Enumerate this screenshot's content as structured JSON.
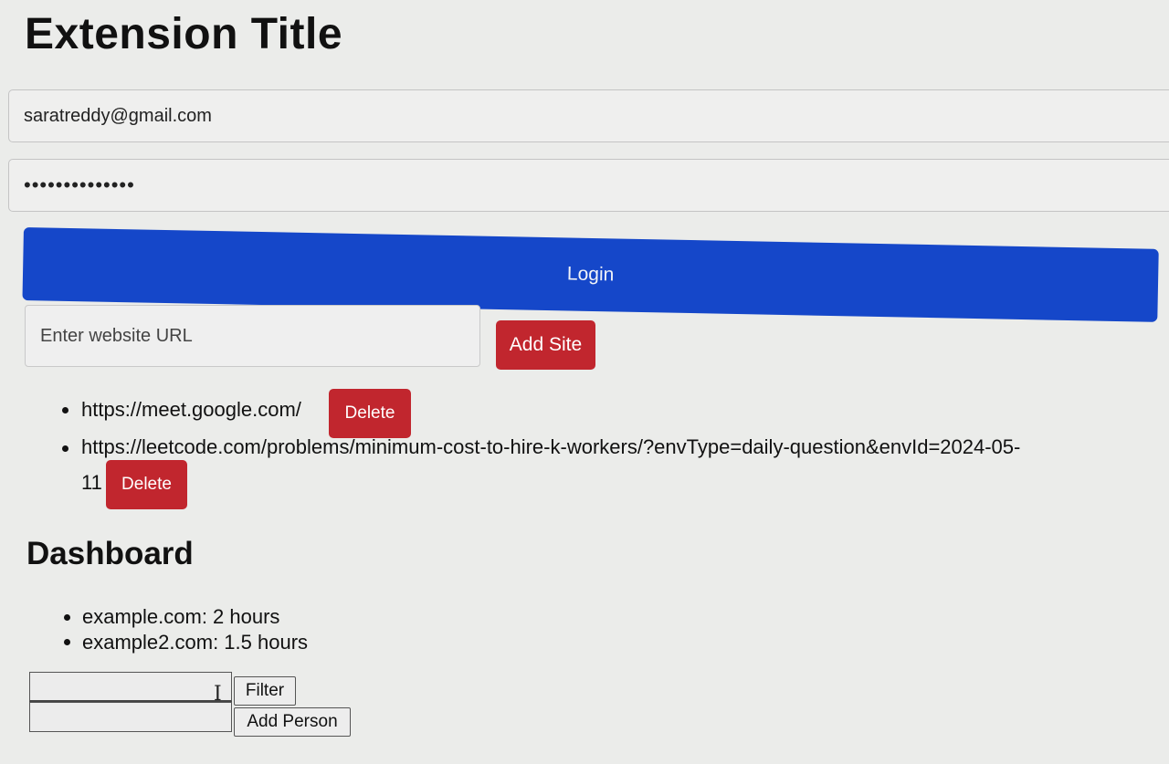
{
  "header": {
    "title": "Extension Title"
  },
  "login": {
    "email_value": "saratreddy@gmail.com",
    "password_value": "••••••••••••••",
    "login_label": "Login"
  },
  "sites": {
    "url_placeholder": "Enter website URL",
    "add_label": "Add Site",
    "items": [
      {
        "url": "https://meet.google.com/",
        "delete_label": "Delete"
      },
      {
        "url_line1": "https://leetcode.com/problems/minimum-cost-to-hire-k-workers/?envType=daily-question&envId=2024-05-",
        "url_line2": "11",
        "delete_label": "Delete"
      }
    ]
  },
  "dashboard": {
    "title": "Dashboard",
    "items": [
      "example.com: 2 hours",
      "example2.com: 1.5 hours"
    ]
  },
  "tools": {
    "filter_label": "Filter",
    "add_person_label": "Add Person"
  },
  "icons": {
    "text_cursor": "I-beam-icon"
  },
  "colors": {
    "login_button": "#1547c9",
    "danger_button": "#c1262e"
  }
}
